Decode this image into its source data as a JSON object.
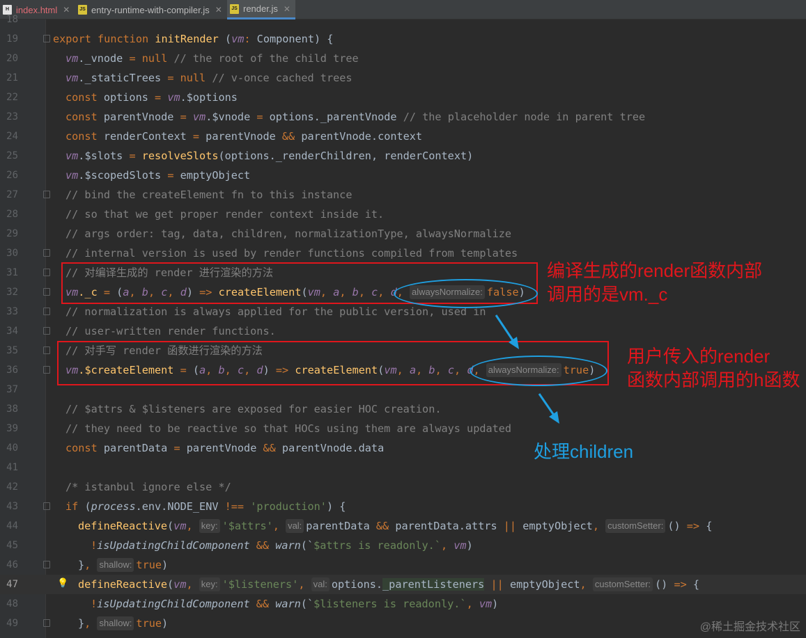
{
  "tabs": [
    {
      "label": "index.html",
      "icon": "H",
      "icon_color": "#e2e2e2",
      "active": false
    },
    {
      "label": "entry-runtime-with-compiler.js",
      "icon": "JS",
      "icon_color": "#d6c23a",
      "active": false
    },
    {
      "label": "render.js",
      "icon": "JS",
      "icon_color": "#d6c23a",
      "active": true
    }
  ],
  "annotations": {
    "box1_line1": "编译生成的render函数内部",
    "box1_line2": "调用的是vm._c",
    "box2_line1": "用户传入的render",
    "box2_line2": "函数内部调用的h函数",
    "children_note": "处理children"
  },
  "watermark": "@稀土掘金技术社区",
  "lines": [
    {
      "n": "18",
      "segs": []
    },
    {
      "n": "19",
      "segs": [
        [
          "export",
          "k"
        ],
        [
          " ",
          "pl"
        ],
        [
          "function",
          "k"
        ],
        [
          " ",
          "pl"
        ],
        [
          "initRender",
          "f"
        ],
        [
          " (",
          "pl"
        ],
        [
          "vm",
          "p"
        ],
        [
          ": ",
          "k"
        ],
        [
          "Component) {",
          "pl"
        ]
      ]
    },
    {
      "n": "20",
      "segs": [
        [
          "vm",
          "p"
        ],
        [
          "._vnode ",
          "pl"
        ],
        [
          "=",
          "k"
        ],
        [
          " ",
          "pl"
        ],
        [
          "null",
          "k"
        ],
        [
          " ",
          "pl"
        ],
        [
          "// the root of the child tree",
          "c"
        ]
      ]
    },
    {
      "n": "21",
      "segs": [
        [
          "vm",
          "p"
        ],
        [
          "._staticTrees ",
          "pl"
        ],
        [
          "=",
          "k"
        ],
        [
          " ",
          "pl"
        ],
        [
          "null",
          "k"
        ],
        [
          " ",
          "pl"
        ],
        [
          "// v-once cached trees",
          "c"
        ]
      ]
    },
    {
      "n": "22",
      "segs": [
        [
          "const",
          "k"
        ],
        [
          " options ",
          "pl"
        ],
        [
          "=",
          "k"
        ],
        [
          " ",
          "pl"
        ],
        [
          "vm",
          "p"
        ],
        [
          ".$options",
          "pl"
        ]
      ]
    },
    {
      "n": "23",
      "segs": [
        [
          "const",
          "k"
        ],
        [
          " parentVnode ",
          "pl"
        ],
        [
          "=",
          "k"
        ],
        [
          " ",
          "pl"
        ],
        [
          "vm",
          "p"
        ],
        [
          ".$vnode ",
          "pl"
        ],
        [
          "=",
          "k"
        ],
        [
          " options._parentVnode ",
          "pl"
        ],
        [
          "// the placeholder node in parent tree",
          "c"
        ]
      ]
    },
    {
      "n": "24",
      "segs": [
        [
          "const",
          "k"
        ],
        [
          " renderContext ",
          "pl"
        ],
        [
          "=",
          "k"
        ],
        [
          " parentVnode ",
          "pl"
        ],
        [
          "&&",
          "k"
        ],
        [
          " parentVnode.context",
          "pl"
        ]
      ]
    },
    {
      "n": "25",
      "segs": [
        [
          "vm",
          "p"
        ],
        [
          ".$slots ",
          "pl"
        ],
        [
          "=",
          "k"
        ],
        [
          " ",
          "pl"
        ],
        [
          "resolveSlots",
          "f"
        ],
        [
          "(options._renderChildren, renderContext)",
          "pl"
        ]
      ]
    },
    {
      "n": "26",
      "segs": [
        [
          "vm",
          "p"
        ],
        [
          ".$scopedSlots ",
          "pl"
        ],
        [
          "=",
          "k"
        ],
        [
          " emptyObject",
          "pl"
        ]
      ]
    },
    {
      "n": "27",
      "segs": [
        [
          "// bind the createElement fn to this instance",
          "c"
        ]
      ]
    },
    {
      "n": "28",
      "segs": [
        [
          "// so that we get proper render context inside it.",
          "c"
        ]
      ]
    },
    {
      "n": "29",
      "segs": [
        [
          "// args order: tag, data, children, normalizationType, alwaysNormalize",
          "c"
        ]
      ]
    },
    {
      "n": "30",
      "segs": [
        [
          "// internal version is used by render functions compiled from templates",
          "c"
        ]
      ]
    },
    {
      "n": "31",
      "segs": [
        [
          "// 对编译生成的 render 进行渲染的方法",
          "c"
        ]
      ]
    },
    {
      "n": "32",
      "segs": [
        [
          "vm",
          "p"
        ],
        [
          "._c ",
          "f"
        ],
        [
          "=",
          "k"
        ],
        [
          " (",
          "pl"
        ],
        [
          "a",
          "p"
        ],
        [
          ", ",
          "k"
        ],
        [
          "b",
          "p"
        ],
        [
          ", ",
          "k"
        ],
        [
          "c",
          "p"
        ],
        [
          ", ",
          "k"
        ],
        [
          "d",
          "p"
        ],
        [
          ") ",
          "pl"
        ],
        [
          "=>",
          "k"
        ],
        [
          " ",
          "pl"
        ],
        [
          "createElement",
          "f"
        ],
        [
          "(",
          "pl"
        ],
        [
          "vm",
          "p"
        ],
        [
          ", ",
          "k"
        ],
        [
          "a",
          "p"
        ],
        [
          ", ",
          "k"
        ],
        [
          "b",
          "p"
        ],
        [
          ", ",
          "k"
        ],
        [
          "c",
          "p"
        ],
        [
          ", ",
          "k"
        ],
        [
          "d",
          "p"
        ],
        [
          ", ",
          "k"
        ],
        [
          "alwaysNormalize:",
          "hint"
        ],
        [
          "false",
          "k"
        ],
        [
          ")",
          "pl"
        ]
      ]
    },
    {
      "n": "33",
      "segs": [
        [
          "// normalization is always applied for the public version, used in",
          "c"
        ]
      ]
    },
    {
      "n": "34",
      "segs": [
        [
          "// user-written render functions.",
          "c"
        ]
      ]
    },
    {
      "n": "35",
      "segs": [
        [
          "// 对手写 render 函数进行渲染的方法",
          "c"
        ]
      ]
    },
    {
      "n": "36",
      "segs": [
        [
          "vm",
          "p"
        ],
        [
          ".$createElement ",
          "f"
        ],
        [
          "=",
          "k"
        ],
        [
          " (",
          "pl"
        ],
        [
          "a",
          "p"
        ],
        [
          ", ",
          "k"
        ],
        [
          "b",
          "p"
        ],
        [
          ", ",
          "k"
        ],
        [
          "c",
          "p"
        ],
        [
          ", ",
          "k"
        ],
        [
          "d",
          "p"
        ],
        [
          ") ",
          "pl"
        ],
        [
          "=>",
          "k"
        ],
        [
          " ",
          "pl"
        ],
        [
          "createElement",
          "f"
        ],
        [
          "(",
          "pl"
        ],
        [
          "vm",
          "p"
        ],
        [
          ", ",
          "k"
        ],
        [
          "a",
          "p"
        ],
        [
          ", ",
          "k"
        ],
        [
          "b",
          "p"
        ],
        [
          ", ",
          "k"
        ],
        [
          "c",
          "p"
        ],
        [
          ", ",
          "k"
        ],
        [
          "d",
          "p"
        ],
        [
          ", ",
          "k"
        ],
        [
          "alwaysNormalize:",
          "hint"
        ],
        [
          "true",
          "k"
        ],
        [
          ")",
          "pl"
        ]
      ]
    },
    {
      "n": "37",
      "segs": []
    },
    {
      "n": "38",
      "segs": [
        [
          "// $attrs & $listeners are exposed for easier HOC creation.",
          "c"
        ]
      ]
    },
    {
      "n": "39",
      "segs": [
        [
          "// they need to be reactive so that HOCs using them are always updated",
          "c"
        ]
      ]
    },
    {
      "n": "40",
      "segs": [
        [
          "const",
          "k"
        ],
        [
          " parentData ",
          "pl"
        ],
        [
          "=",
          "k"
        ],
        [
          " parentVnode ",
          "pl"
        ],
        [
          "&&",
          "k"
        ],
        [
          " parentVnode.data",
          "pl"
        ]
      ]
    },
    {
      "n": "41",
      "segs": []
    },
    {
      "n": "42",
      "segs": [
        [
          "/* istanbul ignore else */",
          "c"
        ]
      ]
    },
    {
      "n": "43",
      "segs": [
        [
          "if",
          "k"
        ],
        [
          " (",
          "pl"
        ],
        [
          "process",
          "it"
        ],
        [
          ".env.NODE_ENV ",
          "pl"
        ],
        [
          "!==",
          "k"
        ],
        [
          " ",
          "pl"
        ],
        [
          "'production'",
          "s"
        ],
        [
          ") {",
          "pl"
        ]
      ]
    },
    {
      "n": "44",
      "segs": [
        [
          "defineReactive",
          "f"
        ],
        [
          "(",
          "pl"
        ],
        [
          "vm",
          "p"
        ],
        [
          ", ",
          "k"
        ],
        [
          "key:",
          "hint"
        ],
        [
          "'$attrs'",
          "s"
        ],
        [
          ", ",
          "k"
        ],
        [
          "val:",
          "hint"
        ],
        [
          "parentData ",
          "pl"
        ],
        [
          "&&",
          "k"
        ],
        [
          " parentData.attrs ",
          "pl"
        ],
        [
          "||",
          "k"
        ],
        [
          " emptyObject",
          "pl"
        ],
        [
          ", ",
          "k"
        ],
        [
          "customSetter:",
          "hint"
        ],
        [
          "() ",
          "pl"
        ],
        [
          "=>",
          "k"
        ],
        [
          " {",
          "pl"
        ]
      ]
    },
    {
      "n": "45",
      "segs": [
        [
          "!",
          "k"
        ],
        [
          "isUpdatingChildComponent",
          "it"
        ],
        [
          " ",
          "pl"
        ],
        [
          "&&",
          "k"
        ],
        [
          " ",
          "pl"
        ],
        [
          "warn",
          "it"
        ],
        [
          "(`",
          "pl"
        ],
        [
          "$attrs is readonly.",
          "s"
        ],
        [
          "`",
          "s"
        ],
        [
          ", ",
          "k"
        ],
        [
          "vm",
          "p"
        ],
        [
          ")",
          "pl"
        ]
      ]
    },
    {
      "n": "46",
      "segs": [
        [
          "}",
          "pl"
        ],
        [
          ", ",
          "k"
        ],
        [
          "shallow:",
          "hint"
        ],
        [
          "true",
          "k"
        ],
        [
          ")",
          "pl"
        ]
      ]
    },
    {
      "n": "47",
      "segs": [
        [
          "defineReactive",
          "f"
        ],
        [
          "(",
          "pl"
        ],
        [
          "vm",
          "p"
        ],
        [
          ", ",
          "k"
        ],
        [
          "key:",
          "hint"
        ],
        [
          "'$listeners'",
          "s"
        ],
        [
          ", ",
          "k"
        ],
        [
          "val:",
          "hint"
        ],
        [
          "options.",
          "pl"
        ],
        [
          "_parentListeners",
          "sel"
        ],
        [
          " ",
          "pl"
        ],
        [
          "||",
          "k"
        ],
        [
          " emptyObject",
          "pl"
        ],
        [
          ", ",
          "k"
        ],
        [
          "customSetter:",
          "hint"
        ],
        [
          "() ",
          "pl"
        ],
        [
          "=>",
          "k"
        ],
        [
          " {",
          "pl"
        ]
      ]
    },
    {
      "n": "48",
      "segs": [
        [
          "!",
          "k"
        ],
        [
          "isUpdatingChildComponent",
          "it"
        ],
        [
          " ",
          "pl"
        ],
        [
          "&&",
          "k"
        ],
        [
          " ",
          "pl"
        ],
        [
          "warn",
          "it"
        ],
        [
          "(`",
          "pl"
        ],
        [
          "$listeners is readonly.",
          "s"
        ],
        [
          "`",
          "s"
        ],
        [
          ", ",
          "k"
        ],
        [
          "vm",
          "p"
        ],
        [
          ")",
          "pl"
        ]
      ]
    },
    {
      "n": "49",
      "segs": [
        [
          "}",
          "pl"
        ],
        [
          ", ",
          "k"
        ],
        [
          "shallow:",
          "hint"
        ],
        [
          "true",
          "k"
        ],
        [
          ")",
          "pl"
        ]
      ]
    }
  ]
}
